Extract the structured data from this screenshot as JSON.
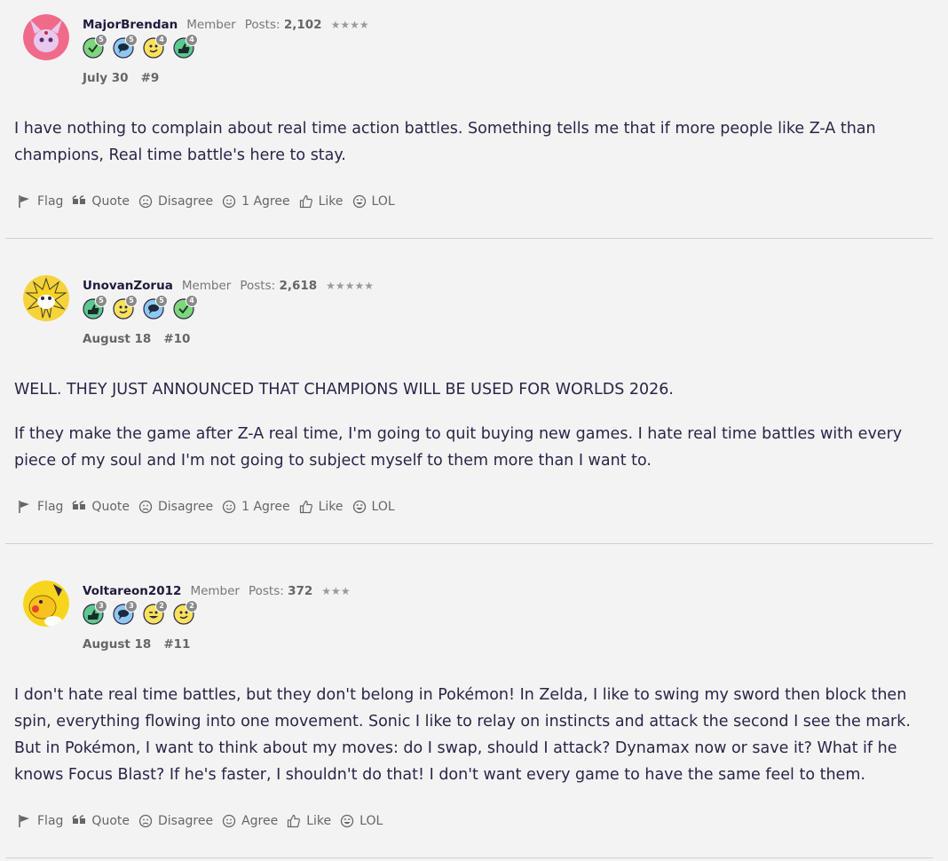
{
  "posts": [
    {
      "username": "MajorBrendan",
      "role": "Member",
      "posts_label": "Posts:",
      "posts_count": "2,102",
      "stars": "★★★★",
      "badges": [
        {
          "icon": "check-badge-icon",
          "count": "5",
          "color": "#4caf50"
        },
        {
          "icon": "speech-badge-icon",
          "count": "5",
          "color": "#3a8fd6"
        },
        {
          "icon": "smiley-badge-icon",
          "count": "4",
          "color": "#f2d21d"
        },
        {
          "icon": "thumbs-badge-icon",
          "count": "4",
          "color": "#2e9e6b"
        }
      ],
      "date": "July 30",
      "number": "#9",
      "paragraphs": [
        "I have nothing to complain about real time action battles. Something tells me that if more people like Z-A than champions, Real time battle's here to stay."
      ],
      "actions": {
        "flag": "Flag",
        "quote": "Quote",
        "disagree": "Disagree",
        "agree": "1 Agree",
        "like": "Like",
        "lol": "LOL"
      }
    },
    {
      "username": "UnovanZorua",
      "role": "Member",
      "posts_label": "Posts:",
      "posts_count": "2,618",
      "stars": "★★★★★",
      "badges": [
        {
          "icon": "thumbs-badge-icon",
          "count": "5",
          "color": "#2e9e6b"
        },
        {
          "icon": "smiley-badge-icon",
          "count": "5",
          "color": "#f2d21d"
        },
        {
          "icon": "speech-badge-icon",
          "count": "5",
          "color": "#3a8fd6"
        },
        {
          "icon": "check-badge-icon",
          "count": "4",
          "color": "#4caf50"
        }
      ],
      "date": "August 18",
      "number": "#10",
      "paragraphs": [
        "WELL. THEY JUST ANNOUNCED THAT CHAMPIONS WILL BE USED FOR WORLDS 2026.",
        "If they make the game after Z-A real time, I'm going to quit buying new games. I hate real time battles with every piece of my soul and I'm not going to subject myself to them more than I want to."
      ],
      "actions": {
        "flag": "Flag",
        "quote": "Quote",
        "disagree": "Disagree",
        "agree": "1 Agree",
        "like": "Like",
        "lol": "LOL"
      }
    },
    {
      "username": "Voltareon2012",
      "role": "Member",
      "posts_label": "Posts:",
      "posts_count": "372",
      "stars": "★★★",
      "badges": [
        {
          "icon": "thumbs-badge-icon",
          "count": "3",
          "color": "#2e9e6b"
        },
        {
          "icon": "speech-badge-icon",
          "count": "3",
          "color": "#3a8fd6"
        },
        {
          "icon": "wink-badge-icon",
          "count": "2",
          "color": "#f2d21d"
        },
        {
          "icon": "smiley-badge-icon",
          "count": "2",
          "color": "#f2d21d"
        }
      ],
      "date": "August 18",
      "number": "#11",
      "paragraphs": [
        "I don't hate real time battles, but they don't belong in Pokémon! In Zelda, I like to swing my sword then block then spin, everything flowing into one movement. Sonic I like to relay on instincts and attack the second I see the mark. But in Pokémon, I want to think about my moves: do I swap, should I attack? Dynamax now or save it? What if he knows Focus Blast? If he's faster, I shouldn't do that! I don't want every game to have the same feel to them."
      ],
      "actions": {
        "flag": "Flag",
        "quote": "Quote",
        "disagree": "Disagree",
        "agree": "Agree",
        "like": "Like",
        "lol": "LOL"
      }
    }
  ]
}
